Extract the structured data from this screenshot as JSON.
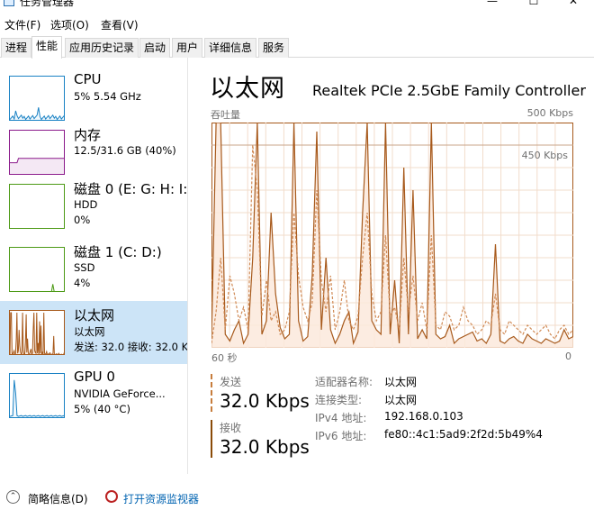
{
  "window": {
    "title": "任务管理器",
    "min": "—",
    "max": "☐",
    "close": "✕"
  },
  "menu": {
    "file": "文件(F)",
    "options": "选项(O)",
    "view": "查看(V)"
  },
  "tabs": [
    "进程",
    "性能",
    "应用历史记录",
    "启动",
    "用户",
    "详细信息",
    "服务"
  ],
  "active_tab": "性能",
  "sidebar": {
    "items": [
      {
        "name": "CPU",
        "sub": "5%  5.54 GHz",
        "sub2": "",
        "color": "#1a82c4",
        "fill": "#f1f8fd"
      },
      {
        "name": "内存",
        "sub": "12.5/31.6 GB (40%)",
        "sub2": "",
        "color": "#8b1a8b",
        "fill": "#f4e8f4"
      },
      {
        "name": "磁盘 0 (E: G: H: I:",
        "sub": "HDD",
        "sub2": "0%",
        "color": "#4d9a16",
        "fill": "#eef7e8"
      },
      {
        "name": "磁盘 1 (C: D:)",
        "sub": "SSD",
        "sub2": "4%",
        "color": "#4d9a16",
        "fill": "#eef7e8"
      },
      {
        "name": "以太网",
        "sub": "以太网",
        "sub2": "发送: 32.0  接收: 32.0 K",
        "color": "#a7591b",
        "fill": "#fbeee4"
      },
      {
        "name": "GPU 0",
        "sub": "NVIDIA GeForce...",
        "sub2": "5% (40 °C)",
        "color": "#1a82c4",
        "fill": "#f1f8fd"
      }
    ],
    "active_index": 4
  },
  "main": {
    "title": "以太网",
    "adapter": "Realtek PCIe 2.5GbE Family Controller",
    "graph_label": "吞吐量",
    "graph_max": "500 Kbps",
    "graph_line_label": "450 Kbps",
    "axis_left": "60 秒",
    "axis_right": "0",
    "send_label": "发送",
    "send_value": "32.0 Kbps",
    "recv_label": "接收",
    "recv_value": "32.0 Kbps",
    "props": [
      {
        "k": "适配器名称:",
        "v": "以太网"
      },
      {
        "k": "连接类型:",
        "v": "以太网"
      },
      {
        "k": "IPv4 地址:",
        "v": "192.168.0.103"
      },
      {
        "k": "IPv6 地址:",
        "v": "fe80::4c1:5ad9:2f2d:5b49%4"
      }
    ]
  },
  "footer": {
    "brief": "简略信息(D)",
    "monitor": "打开资源监视器"
  },
  "chart_data": {
    "type": "line",
    "title": "吞吐量",
    "xlabel": "",
    "ylabel": "",
    "x_range": [
      60,
      0
    ],
    "ylim": [
      0,
      500
    ],
    "reference_line": 450,
    "series": [
      {
        "name": "接收",
        "style": "solid",
        "color": "#a7591b",
        "values": [
          20,
          500,
          500,
          30,
          15,
          40,
          60,
          10,
          30,
          200,
          500,
          30,
          60,
          300,
          120,
          45,
          20,
          30,
          500,
          60,
          15,
          25,
          160,
          480,
          40,
          200,
          40,
          10,
          30,
          60,
          80,
          10,
          35,
          300,
          500,
          60,
          40,
          30,
          500,
          30,
          150,
          10,
          400,
          30,
          350,
          20,
          40,
          20,
          500,
          30,
          20,
          25,
          50,
          10,
          20,
          25,
          30,
          35,
          15,
          20,
          10,
          30,
          230,
          15,
          10,
          20,
          25,
          15,
          10,
          30,
          20,
          15,
          10,
          20,
          15,
          10,
          15,
          40,
          20,
          25
        ]
      },
      {
        "name": "发送",
        "style": "dashed",
        "color": "#d08a55",
        "values": [
          10,
          80,
          200,
          40,
          160,
          120,
          60,
          90,
          40,
          450,
          350,
          70,
          150,
          60,
          80,
          30,
          40,
          80,
          300,
          160,
          90,
          60,
          100,
          350,
          150,
          80,
          160,
          40,
          80,
          150,
          60,
          40,
          70,
          200,
          300,
          120,
          60,
          80,
          250,
          70,
          90,
          40,
          200,
          80,
          160,
          60,
          100,
          40,
          250,
          50,
          40,
          80,
          70,
          40,
          50,
          90,
          60,
          50,
          30,
          40,
          60,
          50,
          120,
          40,
          30,
          60,
          50,
          40,
          30,
          50,
          40,
          30,
          40,
          50,
          30,
          20,
          40,
          50,
          30,
          40
        ]
      }
    ]
  }
}
